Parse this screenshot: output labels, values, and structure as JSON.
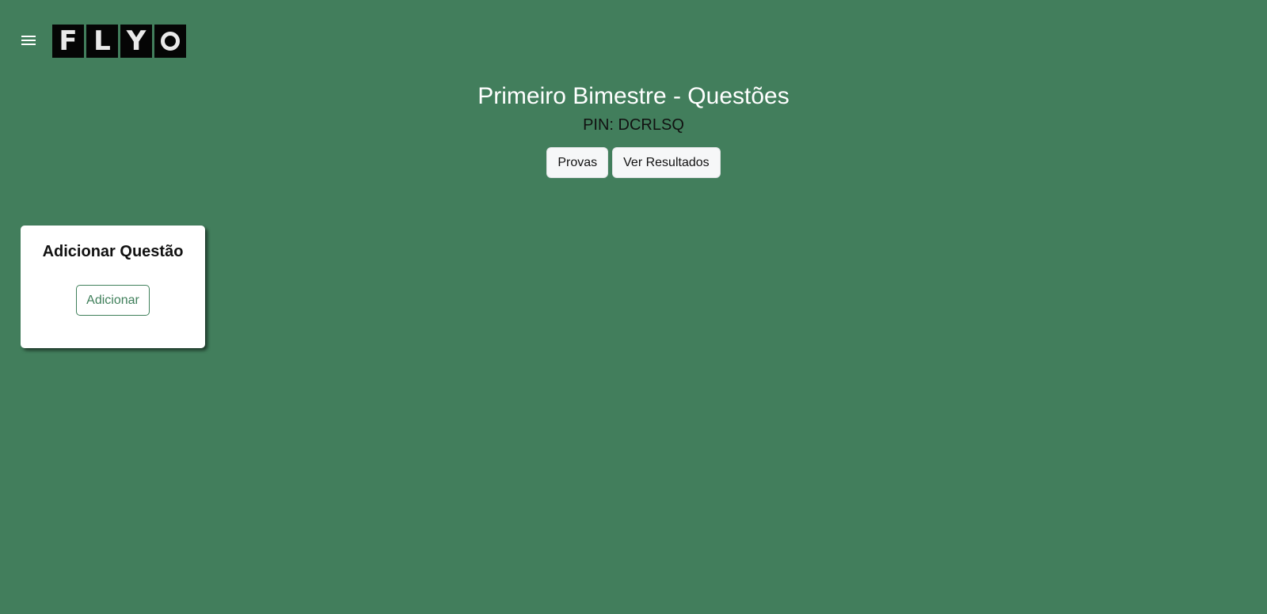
{
  "app": {
    "logo_letters": [
      "F",
      "L",
      "Y",
      "O"
    ],
    "colors": {
      "background": "#427e5c",
      "accent": "#3f7f5a",
      "button_bg": "#f6f7f8",
      "logo_tile": "#050505"
    }
  },
  "header": {
    "menu_icon": "hamburger-menu-icon",
    "title": "Primeiro Bimestre - Questões",
    "pin_label": "PIN:",
    "pin_value": "DCRLSQ",
    "actions": [
      {
        "label": "Provas"
      },
      {
        "label": "Ver Resultados"
      }
    ]
  },
  "card": {
    "title": "Adicionar Questão",
    "button_label": "Adicionar"
  }
}
